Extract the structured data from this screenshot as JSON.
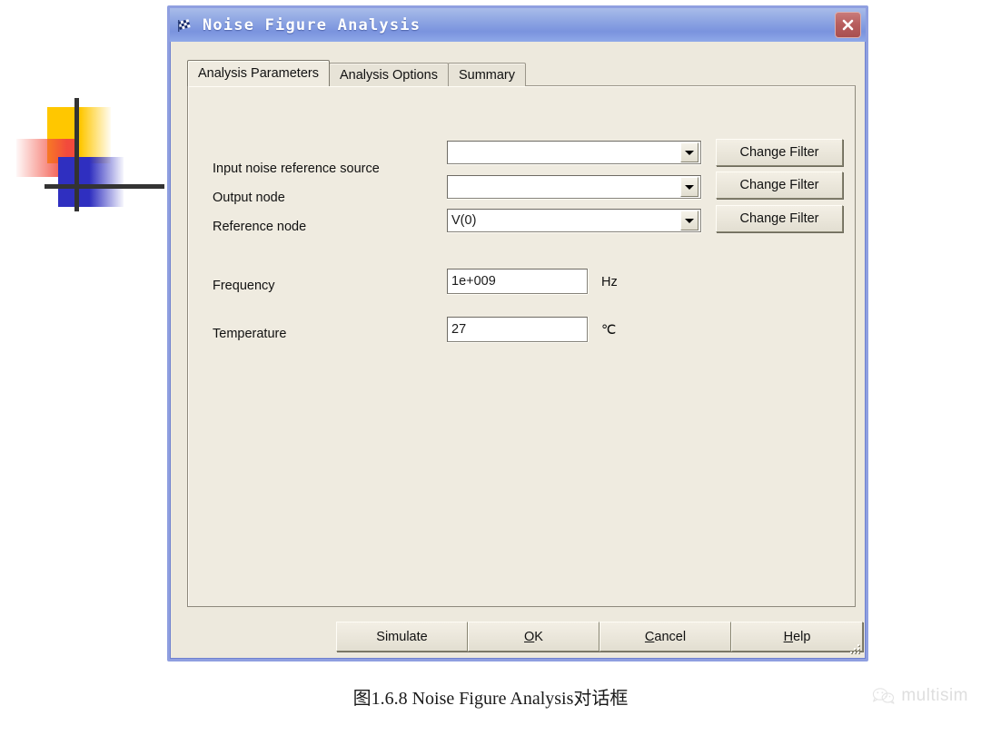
{
  "window": {
    "title": "Noise Figure Analysis",
    "icon": "checkered-flag-icon",
    "close_label": "×",
    "accent_titlebar": "#8ba3e2",
    "accent_border": "#8f9fe0",
    "background": "#EDE9DD"
  },
  "tabs": [
    {
      "label": "Analysis Parameters",
      "active": true
    },
    {
      "label": "Analysis Options",
      "active": false
    },
    {
      "label": "Summary",
      "active": false
    }
  ],
  "form": {
    "rows": [
      {
        "label": "Input noise reference source",
        "value": "",
        "button": "Change Filter"
      },
      {
        "label": "Output node",
        "value": "",
        "button": "Change Filter"
      },
      {
        "label": "Reference node",
        "value": "V(0)",
        "button": "Change Filter"
      }
    ],
    "frequency": {
      "label": "Frequency",
      "value": "1e+009",
      "unit": "Hz"
    },
    "temperature": {
      "label": "Temperature",
      "value": "27",
      "unit": "℃"
    }
  },
  "footer": {
    "buttons": [
      {
        "label": "Simulate",
        "accel": ""
      },
      {
        "label": "OK",
        "accel": "O"
      },
      {
        "label": "Cancel",
        "accel": "C"
      },
      {
        "label": "Help",
        "accel": "H"
      }
    ]
  },
  "caption": "图1.6.8 Noise Figure Analysis对话框",
  "watermark": {
    "text": "multisim",
    "icon": "wechat-icon"
  },
  "decoration": {
    "name": "multisim-logo-art",
    "colors": {
      "yellow": "#FFC700",
      "red": "#F24A3C",
      "blue": "#2F2FC0",
      "cross": "#333333"
    }
  }
}
